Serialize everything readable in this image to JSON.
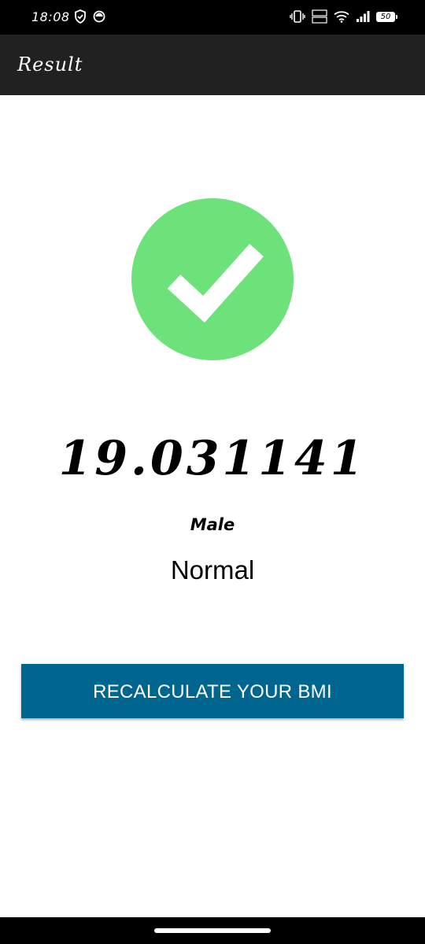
{
  "status_bar": {
    "time": "18:08",
    "left_icons": [
      "shield-check-icon",
      "circle-notification-icon"
    ],
    "right_icons": [
      "vibrate-icon",
      "volte-icon",
      "wifi-icon",
      "signal-icon"
    ],
    "battery_level": "50"
  },
  "app_bar": {
    "title": "Result"
  },
  "result": {
    "icon": "check-circle-icon",
    "icon_color": "#6ee27a",
    "bmi_value": "19.031141",
    "gender": "Male",
    "category": "Normal"
  },
  "actions": {
    "recalculate_label": "RECALCULATE YOUR BMI",
    "button_color": "#006690"
  }
}
